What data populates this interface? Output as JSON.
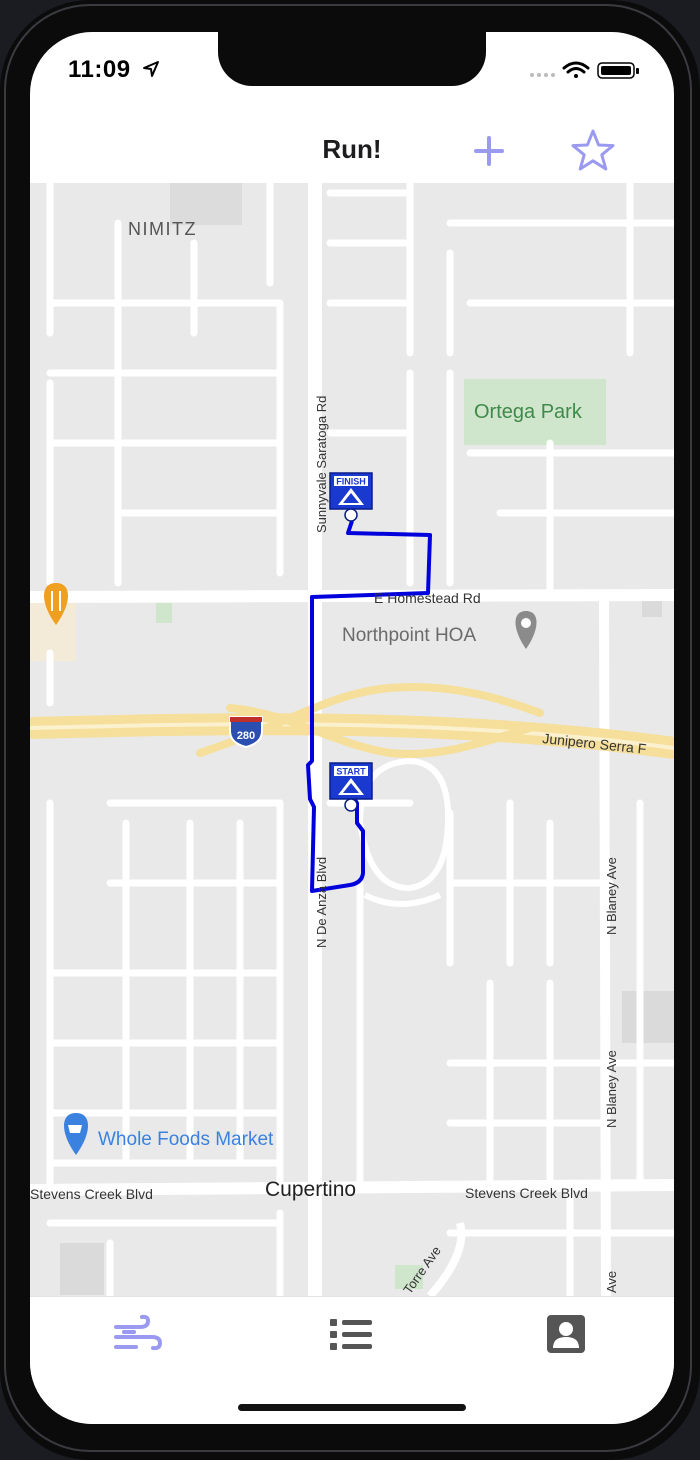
{
  "status_bar": {
    "time": "11:09"
  },
  "navbar": {
    "title": "Run!",
    "add_icon": "plus-icon",
    "favorite_icon": "star-icon",
    "accent": "#9a9af0"
  },
  "map": {
    "labels": {
      "nimitz": "NIMITZ",
      "ortega_park": "Ortega Park",
      "homestead": "E Homestead Rd",
      "northpoint": "Northpoint HOA",
      "junipero": "Junipero Serra F",
      "freeway_shield": "280",
      "saratoga": "Sunnyvale Saratoga Rd",
      "de_anza": "N De Anza Blvd",
      "blaney_1": "N Blaney Ave",
      "blaney_2": "N Blaney Ave",
      "blaney_3": "Ave",
      "whole_foods": "Whole Foods Market",
      "cupertino": "Cupertino",
      "stevens_left": "Stevens Creek Blvd",
      "stevens_right": "Stevens Creek Blvd",
      "torre": "Torre Ave"
    },
    "markers": {
      "finish": "FINISH",
      "start": "START"
    },
    "colors": {
      "route": "#0000dd",
      "freeway": "#f5df9a",
      "park": "#cfe5cc",
      "poi_blue": "#3b82e0",
      "poi_orange": "#f0a020"
    }
  },
  "tabbar": {
    "tabs": [
      {
        "icon": "wind-icon",
        "active": true
      },
      {
        "icon": "list-icon",
        "active": false
      },
      {
        "icon": "profile-icon",
        "active": false
      }
    ]
  }
}
